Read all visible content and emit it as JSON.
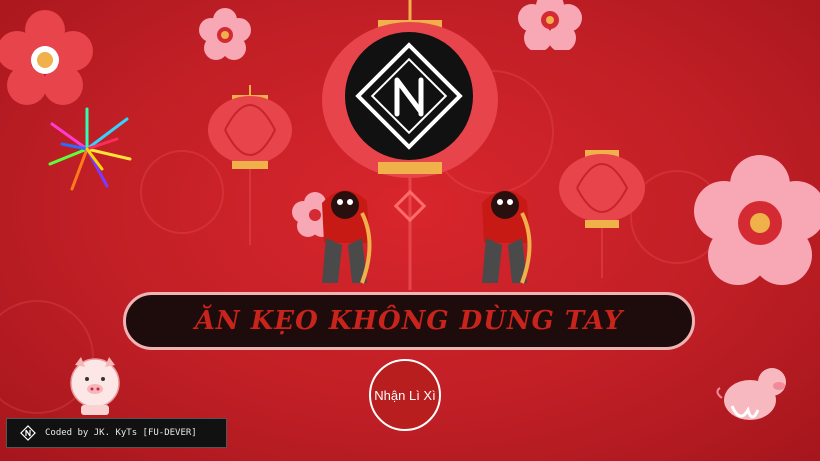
{
  "headline": "ĂN KẸO KHÔNG DÙNG TAY",
  "button": {
    "label": "Nhận Lì Xì"
  },
  "credit": {
    "text": "Coded by JK. KyTs [FU-DEVER]"
  },
  "colors": {
    "background": "#c11f26",
    "bar": "#1e0c0c",
    "headline": "#c8241c",
    "gold": "#f0b04a",
    "blossom": "#f7a8b4"
  },
  "icons": [
    "logo-icon",
    "lantern-icon",
    "blossom-icon",
    "lion-dancer-icon",
    "pig-icon",
    "firework-icon"
  ]
}
